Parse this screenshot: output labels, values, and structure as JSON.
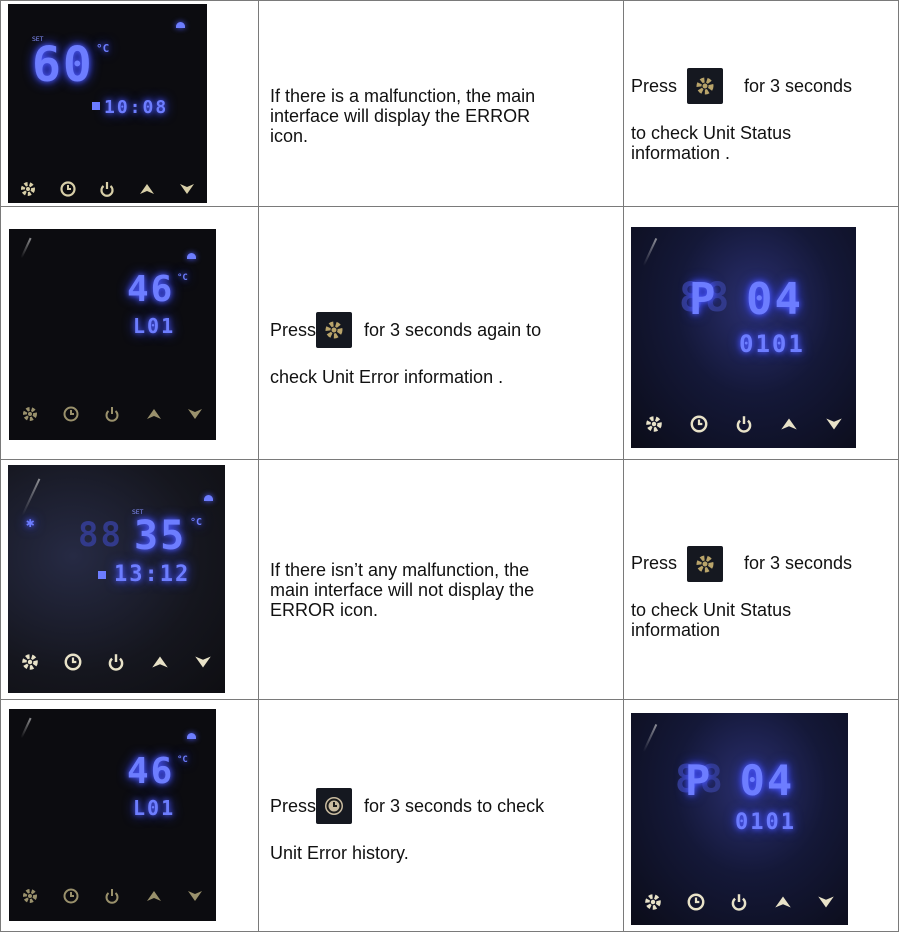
{
  "rows": [
    {
      "display": {
        "temp": "60",
        "time": "10:08",
        "unit": "°C",
        "set_label": "SET"
      },
      "middle_lines": [
        "If there is a malfunction, the main",
        "interface will display the ERROR",
        "icon."
      ],
      "right": {
        "press": "Press",
        "suffix": "for 3 seconds",
        "lines": [
          "to check Unit Status",
          "information ."
        ],
        "icon": "gear-icon"
      }
    },
    {
      "display": {
        "temp": "46",
        "code": "L01",
        "unit": "°C"
      },
      "middle": {
        "press": "Press",
        "suffix": "for 3 seconds again to",
        "line2": "check Unit Error information .",
        "icon": "gear-icon"
      },
      "right_display": {
        "code": "P 04",
        "value": "0101"
      }
    },
    {
      "display": {
        "temp": "35",
        "time": "13:12",
        "unit": "°C",
        "set_label": "SET"
      },
      "middle_lines": [
        "If there isn’t any malfunction, the",
        "main interface will not display the",
        "ERROR icon."
      ],
      "right": {
        "press": "Press",
        "suffix": "for 3 seconds",
        "lines": [
          "to check Unit Status",
          "information"
        ],
        "icon": "gear-icon"
      }
    },
    {
      "display": {
        "temp": "46",
        "code": "L01",
        "unit": "°C"
      },
      "middle": {
        "press": "Press",
        "suffix": "for 3 seconds to check",
        "line2": "Unit Error history.",
        "icon": "clock-icon"
      },
      "right_display": {
        "code": "P 04",
        "value": "0101"
      }
    }
  ],
  "colors": {
    "led": "#6d7dff",
    "panel": "#0c0c10",
    "button": "#d8cfa8"
  }
}
